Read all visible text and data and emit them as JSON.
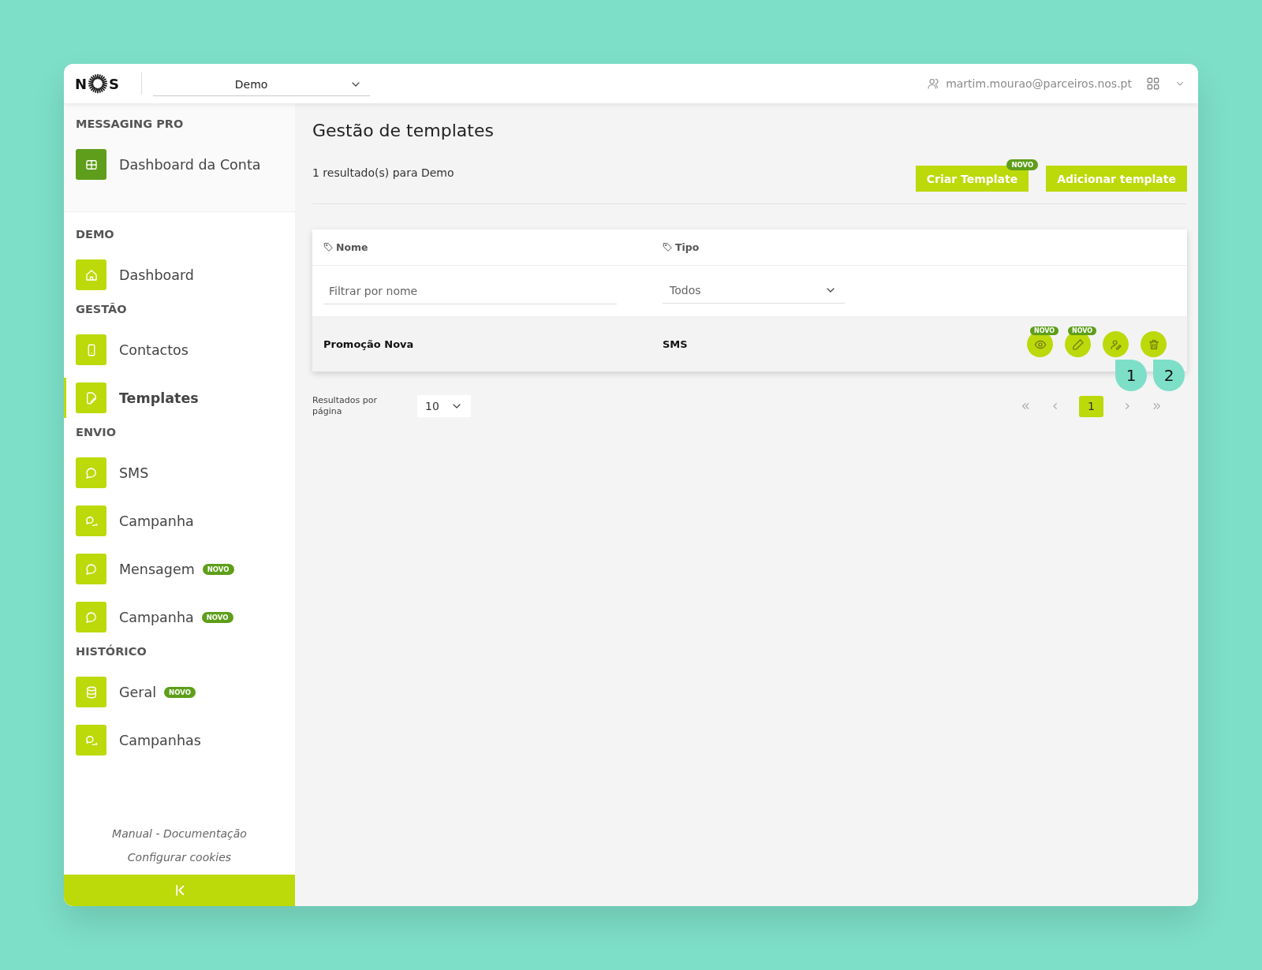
{
  "header": {
    "logo": {
      "before": "N",
      "after": "S"
    },
    "account_select": {
      "value": "Demo"
    },
    "user": "martim.mourao@parceiros.nos.pt"
  },
  "sidebar": {
    "sections": [
      {
        "title": "MESSAGING PRO",
        "items": [
          {
            "label": "Dashboard da Conta",
            "kind": "account",
            "selected": false
          }
        ]
      },
      {
        "title": "DEMO",
        "items": [
          {
            "label": "Dashboard",
            "kind": "page",
            "selected": false
          }
        ]
      },
      {
        "title": "GESTÃO",
        "items": [
          {
            "label": "Contactos",
            "kind": "page",
            "selected": false
          },
          {
            "label": "Templates",
            "kind": "page",
            "selected": true
          }
        ]
      },
      {
        "title": "ENVIO",
        "items": [
          {
            "label": "SMS",
            "kind": "page",
            "selected": false
          },
          {
            "label": "Campanha",
            "kind": "page",
            "selected": false
          },
          {
            "label": "Mensagem",
            "kind": "page",
            "selected": false,
            "badge": "NOVO"
          },
          {
            "label": "Campanha",
            "kind": "page",
            "selected": false,
            "badge": "NOVO"
          }
        ]
      },
      {
        "title": "HISTÓRICO",
        "items": [
          {
            "label": "Geral",
            "kind": "page",
            "selected": false,
            "badge": "NOVO"
          },
          {
            "label": "Campanhas",
            "kind": "page",
            "selected": false
          }
        ]
      }
    ],
    "footer_links": [
      "Manual - Documentação",
      "Configurar cookies"
    ]
  },
  "main": {
    "title": "Gestão de templates",
    "result_count": "1 resultado(s) para Demo",
    "buttons": [
      {
        "label": "Criar Template",
        "badge": "NOVO"
      },
      {
        "label": "Adicionar template"
      }
    ],
    "table": {
      "columns": [
        {
          "label": "Nome"
        },
        {
          "label": "Tipo"
        }
      ],
      "filters": {
        "name": {
          "placeholder": "Filtrar por nome"
        },
        "type": {
          "value": "Todos"
        }
      },
      "rows": [
        {
          "name": "Promoção Nova",
          "type": "SMS",
          "actions": [
            {
              "kind": "view",
              "badge": "NOVO"
            },
            {
              "kind": "edit",
              "badge": "NOVO"
            },
            {
              "kind": "assign",
              "callout": "1"
            },
            {
              "kind": "delete",
              "callout": "2"
            }
          ]
        }
      ]
    },
    "pagination": {
      "per_page_label": "Resultados por página",
      "per_page": "10",
      "pages": [
        {
          "label": "1",
          "selected": true
        }
      ]
    }
  }
}
